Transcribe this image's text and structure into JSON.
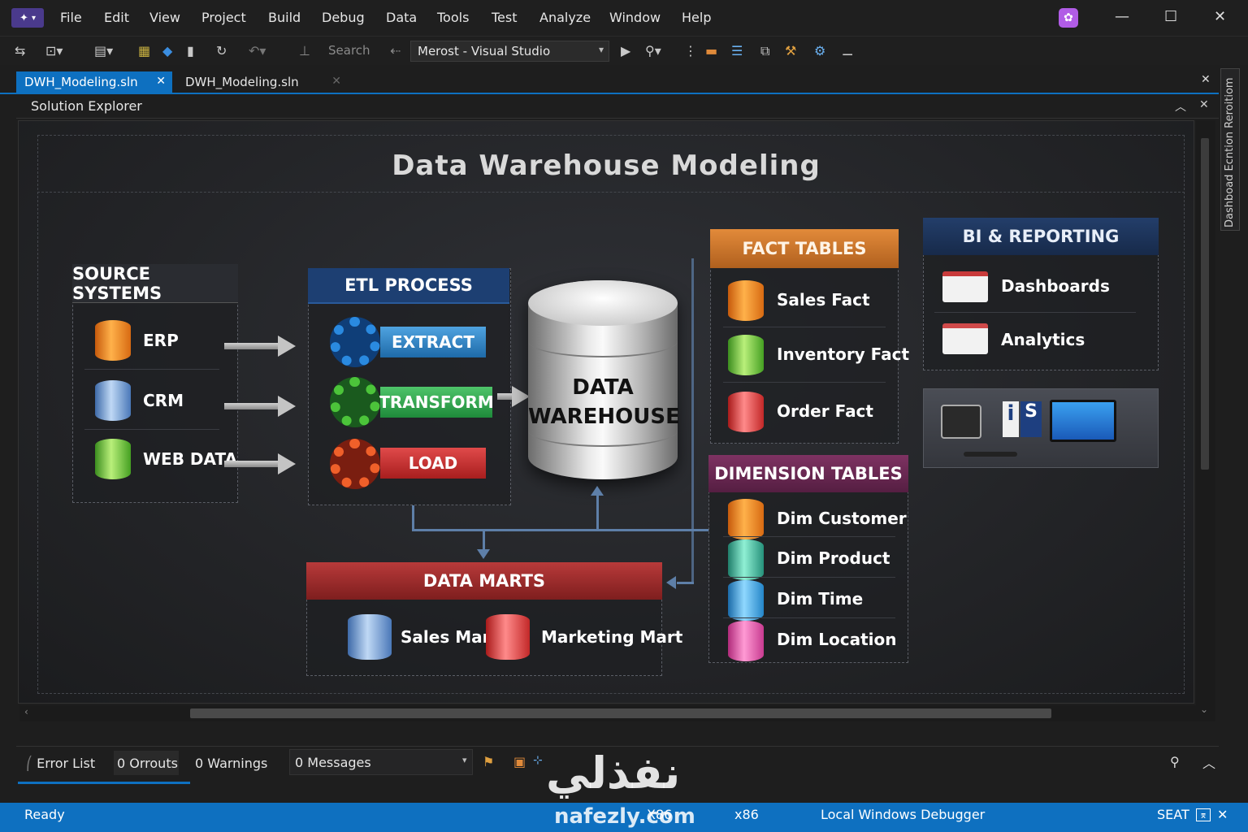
{
  "menu": {
    "items": [
      "File",
      "Edit",
      "View",
      "Project",
      "Build",
      "Debug",
      "Data",
      "Tools",
      "Test",
      "Analyze",
      "Window",
      "Help"
    ]
  },
  "toolbar": {
    "search_label": "Search",
    "config_combo": "Merost - Visual Studio"
  },
  "tabs": [
    {
      "label": "DWH_Modeling.sln",
      "active": true
    },
    {
      "label": "DWH_Modeling.sln",
      "active": false
    }
  ],
  "panel": {
    "title": "Solution Explorer"
  },
  "right_rail": {
    "text": "Dashboad Ecntion Reroitiom"
  },
  "diagram": {
    "title": "Data Warehouse Modeling",
    "source_systems": {
      "header": "SOURCE SYSTEMS",
      "items": [
        "ERP",
        "CRM",
        "WEB DATA"
      ]
    },
    "etl": {
      "header": "ETL PROCESS",
      "steps": [
        "EXTRACT",
        "TRANSFORM",
        "LOAD"
      ]
    },
    "warehouse": {
      "line1": "DATA",
      "line2": "WAREHOUSE"
    },
    "fact_tables": {
      "header": "FACT TABLES",
      "items": [
        "Sales Fact",
        "Inventory Fact",
        "Order Fact"
      ]
    },
    "dimension_tables": {
      "header": "DIMENSION TABLES",
      "items": [
        "Dim Customer",
        "Dim Product",
        "Dim Time",
        "Dim Location"
      ]
    },
    "data_marts": {
      "header": "DATA MARTS",
      "items": [
        "Sales Mart",
        "Marketing Mart"
      ]
    },
    "bi_reporting": {
      "header": "BI & REPORTING",
      "items": [
        "Dashboards",
        "Analytics"
      ]
    },
    "colors": {
      "source_hdr": "#2a2c31",
      "etl_hdr": "#1d3f72",
      "fact_hdr": "#c8752a",
      "dim_hdr": "#6b2a52",
      "marts_hdr": "#9a2a2a",
      "bi_hdr": "#1c3358",
      "extract": "#2a7fc0",
      "transform": "#2e9a4a",
      "load": "#c02a2a"
    }
  },
  "bottom_panel": {
    "error_list": "Error List",
    "errors": "0 Orrouts",
    "warnings": "0 Warnings",
    "messages": "0 Messages"
  },
  "status": {
    "ready": "Ready",
    "platform1": "X86",
    "platform2": "x86",
    "debugger": "Local Windows Debugger",
    "right": "SEAT"
  },
  "watermark": {
    "arabic": "نفذلي",
    "latin": "nafezly.com"
  }
}
